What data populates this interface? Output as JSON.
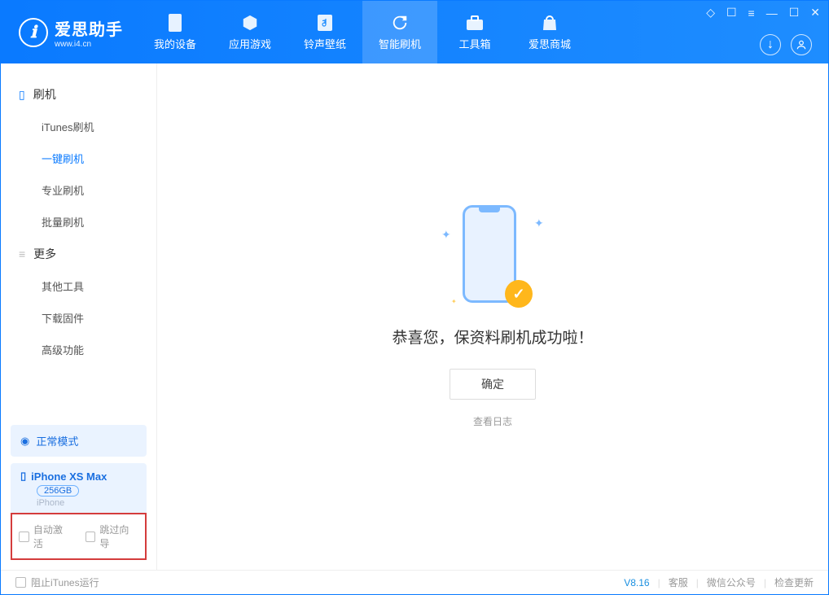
{
  "app": {
    "title": "爱思助手",
    "subtitle": "www.i4.cn"
  },
  "nav": {
    "items": [
      {
        "label": "我的设备"
      },
      {
        "label": "应用游戏"
      },
      {
        "label": "铃声壁纸"
      },
      {
        "label": "智能刷机"
      },
      {
        "label": "工具箱"
      },
      {
        "label": "爱思商城"
      }
    ]
  },
  "sidebar": {
    "section1": "刷机",
    "items1": [
      "iTunes刷机",
      "一键刷机",
      "专业刷机",
      "批量刷机"
    ],
    "section2": "更多",
    "items2": [
      "其他工具",
      "下载固件",
      "高级功能"
    ],
    "mode_label": "正常模式",
    "device_name": "iPhone XS Max",
    "device_storage": "256GB",
    "device_type": "iPhone",
    "chk_auto_activate": "自动激活",
    "chk_skip_guide": "跳过向导"
  },
  "main": {
    "success": "恭喜您，保资料刷机成功啦！",
    "ok": "确定",
    "view_log": "查看日志"
  },
  "footer": {
    "block_itunes": "阻止iTunes运行",
    "version": "V8.16",
    "support": "客服",
    "wechat": "微信公众号",
    "update": "检查更新"
  }
}
